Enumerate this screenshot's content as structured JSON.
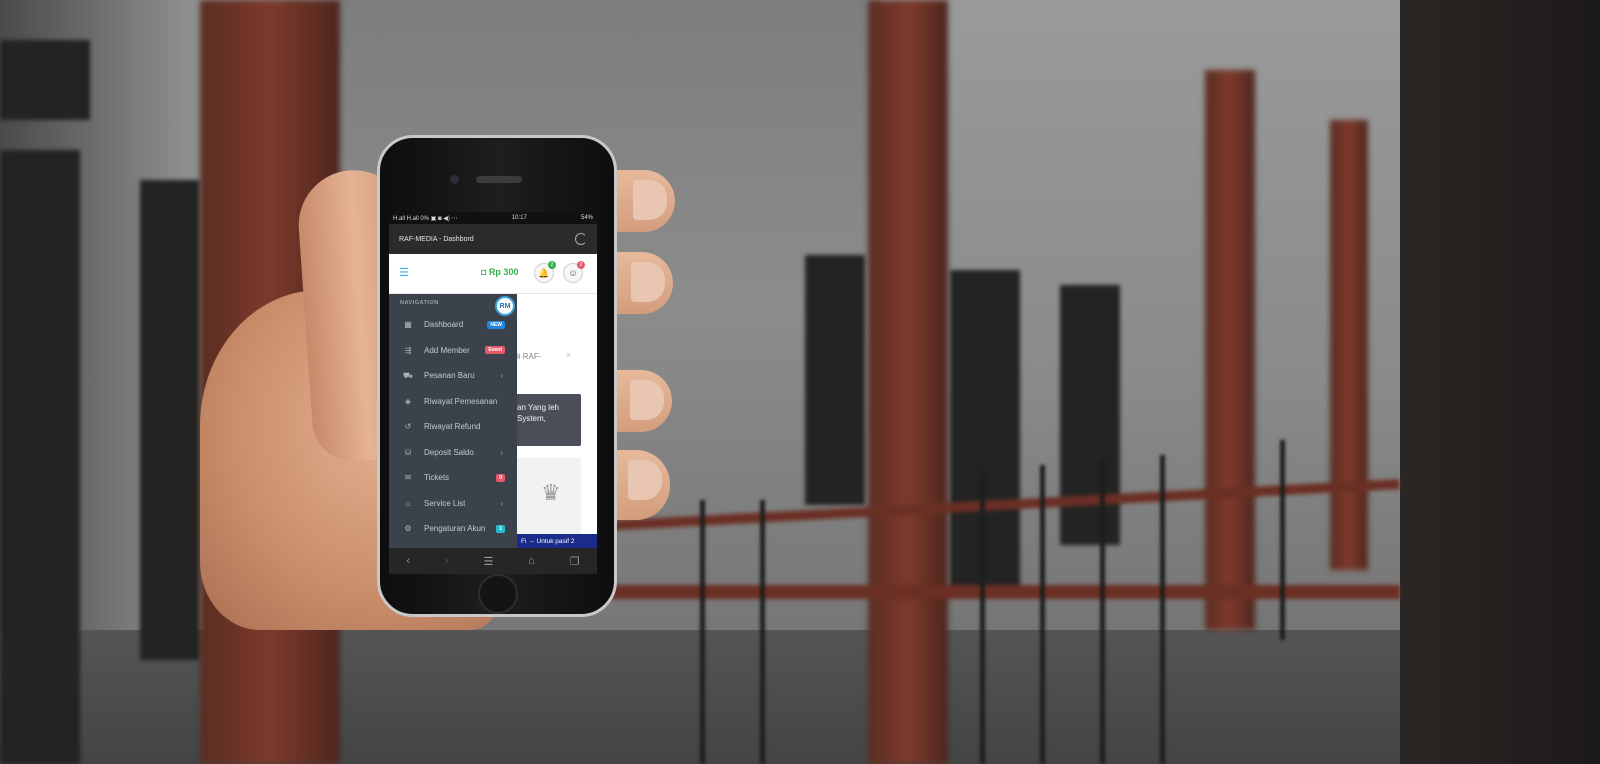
{
  "status_bar": {
    "left": "H.all H.all 0% ▣ ◙ ◀) ⋯",
    "time": "10:17",
    "right": "54%"
  },
  "browser": {
    "title": "RAF-MEDIA - Dashbord"
  },
  "header": {
    "balance": "Rp 300",
    "notification_count": "2",
    "profile_count": "2"
  },
  "content": {
    "alert_text": "Di RAF-",
    "alert_close": "×",
    "box_text": "an Yang leh System,",
    "ticker": "Fi → Untuk pasif  2"
  },
  "drawer": {
    "title": "NAVIGATION",
    "logo": "RM",
    "items": [
      {
        "label": "Dashboard",
        "badge": "NEW",
        "badge_color": "#1e88e5",
        "icon": "dashboard-icon"
      },
      {
        "label": "Add Member",
        "badge": "Event",
        "badge_color": "#e55a6a",
        "icon": "add-member-icon"
      },
      {
        "label": "Pesanan Baru",
        "chevron": "›",
        "icon": "cart-icon"
      },
      {
        "label": "Riwayat Pemesanan",
        "icon": "layers-icon"
      },
      {
        "label": "Riwayat Refund",
        "icon": "history-icon"
      },
      {
        "label": "Deposit Saldo",
        "chevron": "›",
        "icon": "coins-icon"
      },
      {
        "label": "Tickets",
        "badge": "0",
        "badge_color": "#e55a6a",
        "icon": "envelope-icon"
      },
      {
        "label": "Service List",
        "chevron": "›",
        "icon": "bank-icon"
      },
      {
        "label": "Pengaturan Akun",
        "badge": "1",
        "badge_color": "#26bcd0",
        "icon": "user-settings-icon"
      }
    ]
  },
  "colors": {
    "drawer_bg": "#3b424b",
    "balance_green": "#35b04a",
    "accent_blue": "#3ab0e8"
  }
}
